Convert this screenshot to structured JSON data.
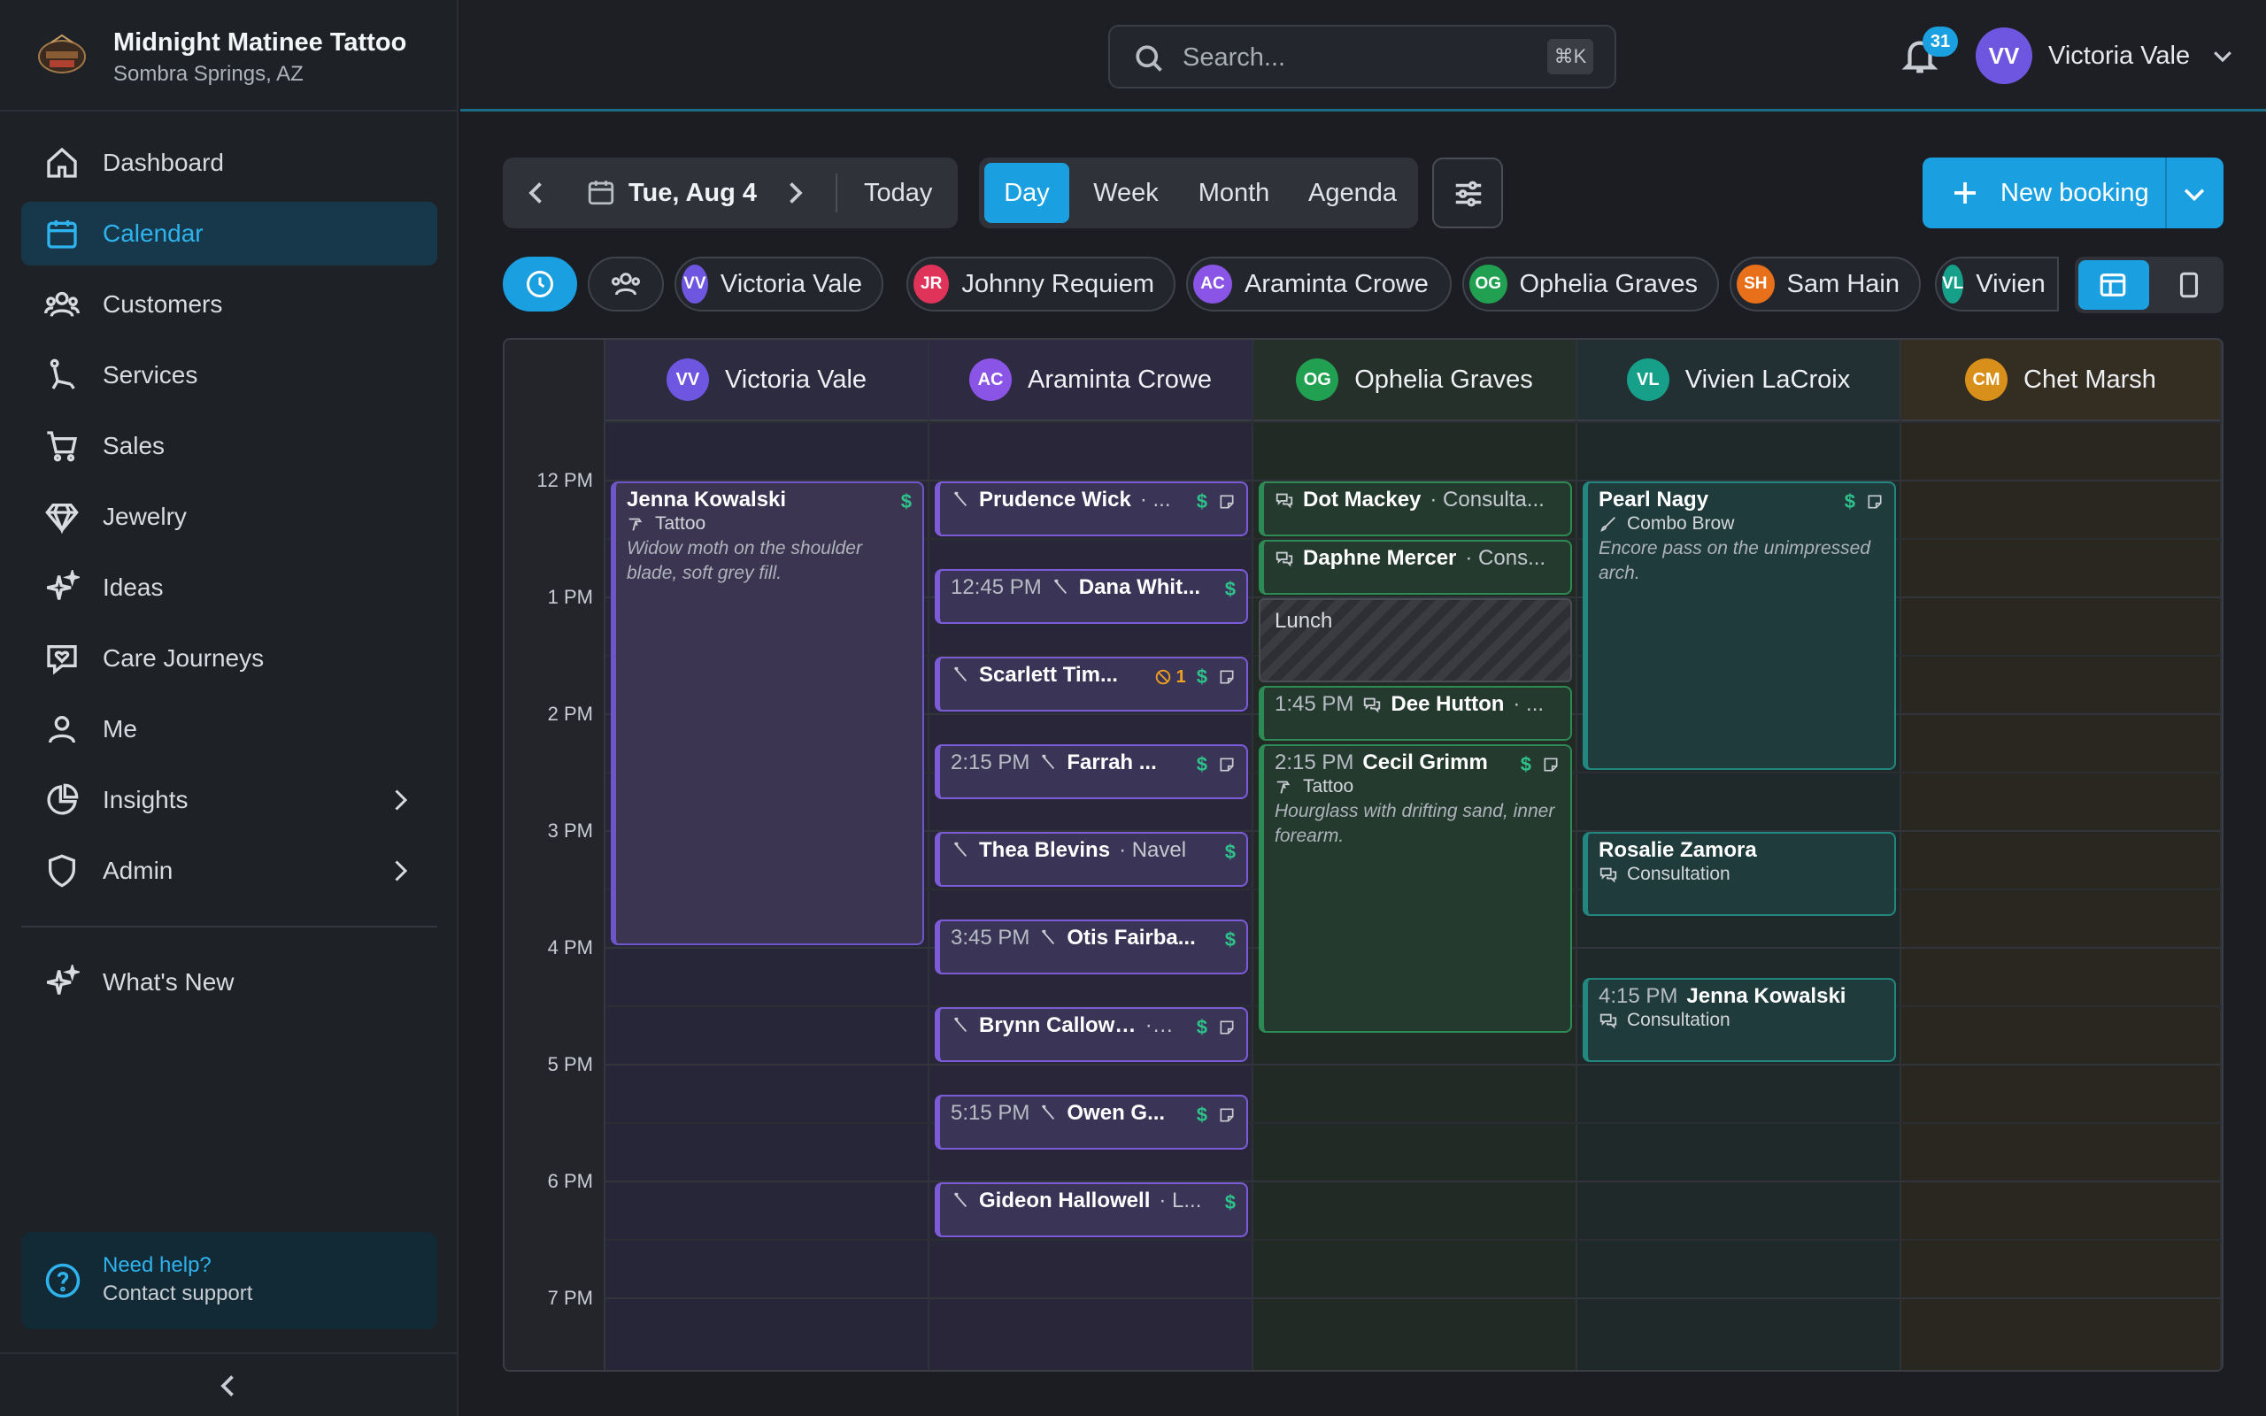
{
  "brand": {
    "name": "Midnight Matinee Tattoo",
    "location": "Sombra Springs, AZ"
  },
  "nav": {
    "items": [
      {
        "label": "Dashboard",
        "icon": "home-icon"
      },
      {
        "label": "Calendar",
        "icon": "calendar-icon",
        "active": true
      },
      {
        "label": "Customers",
        "icon": "users-icon"
      },
      {
        "label": "Services",
        "icon": "needle-icon"
      },
      {
        "label": "Sales",
        "icon": "cart-icon"
      },
      {
        "label": "Jewelry",
        "icon": "diamond-icon"
      },
      {
        "label": "Ideas",
        "icon": "sparkles-icon"
      },
      {
        "label": "Care Journeys",
        "icon": "heart-chat-icon"
      },
      {
        "label": "Me",
        "icon": "person-icon"
      },
      {
        "label": "Insights",
        "icon": "pie-chart-icon"
      },
      {
        "label": "Admin",
        "icon": "shield-icon"
      }
    ],
    "whats_new": "What's New"
  },
  "help": {
    "title": "Need help?",
    "subtitle": "Contact support"
  },
  "search": {
    "placeholder": "Search...",
    "shortcut": "⌘K"
  },
  "notifications": {
    "count": "31"
  },
  "user": {
    "initials": "VV",
    "name": "Victoria Vale"
  },
  "toolbar": {
    "date": "Tue, Aug 4",
    "today": "Today",
    "views": [
      "Day",
      "Week",
      "Month",
      "Agenda"
    ],
    "active_view": "Day",
    "new_booking": "New booking"
  },
  "staff_chips": [
    {
      "initials": "VV",
      "name": "Victoria Vale",
      "color": "#6e56e0"
    },
    {
      "initials": "JR",
      "name": "Johnny Requiem",
      "color": "#e0335a"
    },
    {
      "initials": "AC",
      "name": "Araminta Crowe",
      "color": "#8a55e6"
    },
    {
      "initials": "OG",
      "name": "Ophelia Graves",
      "color": "#20a050"
    },
    {
      "initials": "SH",
      "name": "Sam Hain",
      "color": "#e8701a"
    },
    {
      "initials": "VL",
      "name": "Vivien",
      "color": "#16a08a"
    }
  ],
  "columns": [
    {
      "initials": "VV",
      "name": "Victoria Vale",
      "color": "#6e56e0",
      "bg": "#272638",
      "hdr": "#2c2b40"
    },
    {
      "initials": "AC",
      "name": "Araminta Crowe",
      "color": "#8a55e6",
      "bg": "#292639",
      "hdr": "#2e2a42"
    },
    {
      "initials": "OG",
      "name": "Ophelia Graves",
      "color": "#20a050",
      "bg": "#222a25",
      "hdr": "#25302a"
    },
    {
      "initials": "VL",
      "name": "Vivien LaCroix",
      "color": "#16a08a",
      "bg": "#20292a",
      "hdr": "#233033"
    },
    {
      "initials": "CM",
      "name": "Chet Marsh",
      "color": "#d9901a",
      "bg": "#2a2721",
      "hdr": "#332d22"
    }
  ],
  "time_labels": [
    "12 PM",
    "1 PM",
    "2 PM",
    "3 PM",
    "4 PM",
    "5 PM",
    "6 PM",
    "7 PM"
  ],
  "events": [
    {
      "col": 0,
      "start": 12.0,
      "end": 16.0,
      "style": "purple",
      "who": "Jenna Kowalski",
      "sub": "Tattoo",
      "sub_icon": "tattoo-gun-icon",
      "desc": "Widow moth on the shoulder blade, soft grey fill.",
      "dollar": true
    },
    {
      "col": 1,
      "start": 12.0,
      "end": 12.5,
      "style": "purple2",
      "who": "Prudence Wick",
      "svc": "· ...",
      "icon": "needle-icon",
      "dollar": true,
      "note": true
    },
    {
      "col": 1,
      "start": 12.75,
      "end": 13.25,
      "style": "purple2",
      "time": "12:45 PM",
      "who": "Dana Whit...",
      "icon": "needle-icon",
      "dollar": true
    },
    {
      "col": 1,
      "start": 13.5,
      "end": 14.0,
      "style": "purple2",
      "who": "Scarlett Tim...",
      "icon": "needle-icon",
      "warn": "1",
      "dollar": true,
      "note": true
    },
    {
      "col": 1,
      "start": 14.25,
      "end": 14.75,
      "style": "purple2",
      "time": "2:15 PM",
      "who": "Farrah ...",
      "icon": "needle-icon",
      "dollar": true,
      "note": true
    },
    {
      "col": 1,
      "start": 15.0,
      "end": 15.5,
      "style": "purple2",
      "who": "Thea Blevins",
      "svc": "· Navel",
      "icon": "needle-icon",
      "dollar": true
    },
    {
      "col": 1,
      "start": 15.75,
      "end": 16.25,
      "style": "purple2",
      "time": "3:45 PM",
      "who": "Otis Fairba...",
      "icon": "needle-icon",
      "dollar": true
    },
    {
      "col": 1,
      "start": 16.5,
      "end": 17.0,
      "style": "purple2",
      "who": "Brynn Calloway",
      "svc": "· ...",
      "icon": "needle-icon",
      "dollar": true,
      "note": true
    },
    {
      "col": 1,
      "start": 17.25,
      "end": 17.75,
      "style": "purple2",
      "time": "5:15 PM",
      "who": "Owen G...",
      "icon": "needle-icon",
      "dollar": true,
      "note": true
    },
    {
      "col": 1,
      "start": 18.0,
      "end": 18.5,
      "style": "purple2",
      "who": "Gideon Hallowell",
      "svc": "· L...",
      "icon": "needle-icon",
      "dollar": true
    },
    {
      "col": 2,
      "start": 12.0,
      "end": 12.5,
      "style": "green",
      "who": "Dot Mackey",
      "svc": "· Consulta...",
      "icon": "chat-icon"
    },
    {
      "col": 2,
      "start": 12.5,
      "end": 13.0,
      "style": "green",
      "who": "Daphne Mercer",
      "svc": "· Cons...",
      "icon": "chat-icon"
    },
    {
      "col": 2,
      "start": 13.75,
      "end": 14.25,
      "style": "green",
      "time": "1:45 PM",
      "who": "Dee Hutton",
      "svc": "· ...",
      "icon": "chat-icon"
    },
    {
      "col": 2,
      "start": 14.25,
      "end": 16.75,
      "style": "green",
      "time": "2:15 PM",
      "who": "Cecil Grimm",
      "sub": "Tattoo",
      "sub_icon": "tattoo-gun-icon",
      "desc": "Hourglass with drifting sand, inner forearm.",
      "dollar": true,
      "note": true
    },
    {
      "col": 3,
      "start": 12.0,
      "end": 14.5,
      "style": "teal",
      "who": "Pearl Nagy",
      "sub": "Combo Brow",
      "sub_icon": "brush-icon",
      "desc": "Encore pass on the unimpressed arch.",
      "dollar": true,
      "note": true
    },
    {
      "col": 3,
      "start": 15.0,
      "end": 15.75,
      "style": "teal",
      "who": "Rosalie Zamora",
      "sub": "Consultation",
      "sub_icon": "chat-icon"
    },
    {
      "col": 3,
      "start": 16.25,
      "end": 17.0,
      "style": "teal",
      "time": "4:15 PM",
      "who": "Jenna Kowalski",
      "sub": "Consultation",
      "sub_icon": "chat-icon"
    }
  ],
  "blocks": [
    {
      "col": 2,
      "start": 13.0,
      "end": 13.75,
      "label": "Lunch"
    }
  ]
}
